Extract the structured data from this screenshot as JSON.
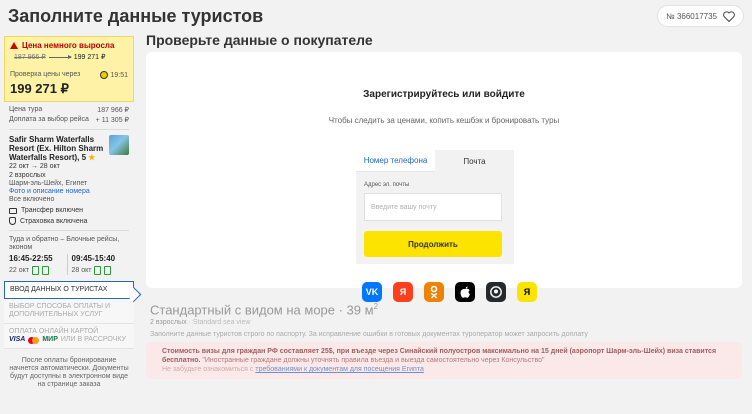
{
  "page": {
    "title": "Заполните данные туристов"
  },
  "order": {
    "number": "№ 366017735"
  },
  "price_alert": {
    "warning": "Цена немного выросла",
    "old_price": "187 966 ₽",
    "new_price": "199 271 ₽",
    "check_label": "Проверка цены через",
    "check_timer": "19:51",
    "total": "199 271 ₽"
  },
  "price_details": [
    {
      "label": "Цена тура",
      "value": "187 966 ₽"
    },
    {
      "label": "Доплата за выбор рейса",
      "value": "+ 11 305 ₽"
    }
  ],
  "hotel": {
    "name": "Safir Sharm Waterfalls Resort (Ex. Hilton Sharm Waterfalls Resort), 5",
    "dates": "22 окт → 28 окт",
    "guests": "2 взрослых",
    "location": "Шарм-эль-Шейх, Египет",
    "link": "Фото и описание номера",
    "meals": "Все включено",
    "transfer": "Трансфер включен",
    "insurance": "Страховка включена"
  },
  "flights": {
    "label": "Туда и обратно – Блочные рейсы, эконом",
    "outbound": {
      "time": "16:45-22:55",
      "date": "22 окт"
    },
    "return": {
      "time": "09:45-15:40",
      "date": "28 окт"
    }
  },
  "steps": {
    "tourists": "Ввод данных о туристах",
    "payment_method": "Выбор способа оплаты и дополнительных услуг",
    "card": "Оплата онлайн картой",
    "visa": "VISA",
    "mir": "МИР",
    "installment_suffix": "или в рассрочку"
  },
  "sidebar_note": "После оплаты бронирование начнется автоматически. Документы будут доступны в электронном виде на странице заказа",
  "buyer": {
    "section_title": "Проверьте данные о покупателе",
    "auth_title": "Зарегистрируйтесь или войдите",
    "auth_subtitle": "Чтобы следить за ценами, копить кешбэк и бронировать туры",
    "tab_phone": "Номер телефона",
    "tab_email": "Почта",
    "email_label": "Адрес эл. почты",
    "email_placeholder": "Введите вашу почту",
    "email_value": "",
    "continue": "Продолжить",
    "socials": [
      "VK",
      "Я",
      "ОК",
      "Apple",
      "GitHub",
      "Я"
    ]
  },
  "room": {
    "title": "Стандартный с видом на море · 39 м",
    "title_sup": "2",
    "guests": "2 взрослых",
    "view": "Standard sea view",
    "note": "Заполните данные туристов строго по паспорту. За исправление ошибки в готовых документах туроператор может запросить доплату",
    "visa_bold": "Стоимость визы для граждан РФ составляет 25$, при въезде через Синайский полуостров максимально на 15 дней (аэропорт Шарм-эль-Шейх) виза ставится бесплатно.",
    "visa_rest": " \"Иностранные граждане должны уточнять правила въезда и выезда самостоятельно через Консульство\"",
    "visa_link_prefix": "Не забудьте ознакомиться с",
    "visa_link": "требованиями к документам для посещения Египта"
  },
  "colors": {
    "accent": "#fde400",
    "link": "#2466c2",
    "warning": "#d10000",
    "alert_bg": "#fdf2a6"
  }
}
